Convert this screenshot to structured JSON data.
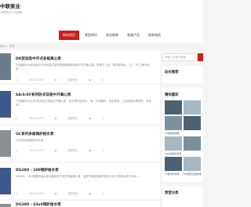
{
  "site": {
    "title": "中联泵业",
    "subtitle": "中联泵业十大品牌"
  },
  "nav": {
    "items": [
      {
        "label": "网站首页",
        "active": true
      },
      {
        "label": "泵型知识",
        "active": false
      },
      {
        "label": "泵业新闻",
        "active": false
      },
      {
        "label": "泵类产品",
        "active": false
      },
      {
        "label": "联系电话",
        "active": false
      }
    ]
  },
  "breadcrumb": "首页 > 泵业",
  "articles": [
    {
      "title": "DK型双吸中开式多级离心泵",
      "desc": "产品概述DK型双吸中开双壳泵式结构是按照单级双吸中开式离心泵，是用于工业、城市给排水、工厂、矿山等行业的……",
      "date": "2023-12-04",
      "category": "泵型知识",
      "views": "4"
    },
    {
      "title": "SA/S/SF系列卧式双吸中开离心泵",
      "desc": "产品概述SA/S/SC系列卧式双吸中开离心泵，用于城市给排水、电厂冷却循环、农田排灌、工业给排水等场所。本系列……",
      "date": "2023-12-04",
      "category": "泵型知识",
      "views": "3"
    },
    {
      "title": "GC系列多级锅炉给水泵",
      "desc": "GC系列多级锅炉给水泵",
      "date": "2023-12-03",
      "category": "泵型知识",
      "views": "3"
    },
    {
      "title": "DG280 - 100钢炉给水泵",
      "desc": "DG280 - 100型钢炉给水泵为单壳体节段式多级离心泵，适用于输送温度不超过180℃的清水或与清水……",
      "date": "2023-12-03",
      "category": "泵型知识",
      "views": "3"
    },
    {
      "title": "DG280 - 43x9钢炉给水泵",
      "desc": "",
      "date": "",
      "category": "",
      "views": ""
    }
  ],
  "sidebar": {
    "search_placeholder": "请输入关键字搜索",
    "block1_title": "站长推荐",
    "block2_title": "猜你喜欢",
    "thumbs": [
      {
        "caption": "YZ型玻璃钢泵"
      },
      {
        "caption": "VDZ多级管道泵"
      },
      {
        "caption": "TC型中开式泵"
      },
      {
        "caption": "MQ型管道消防泵"
      }
    ],
    "block3_title": "泵型分类"
  }
}
